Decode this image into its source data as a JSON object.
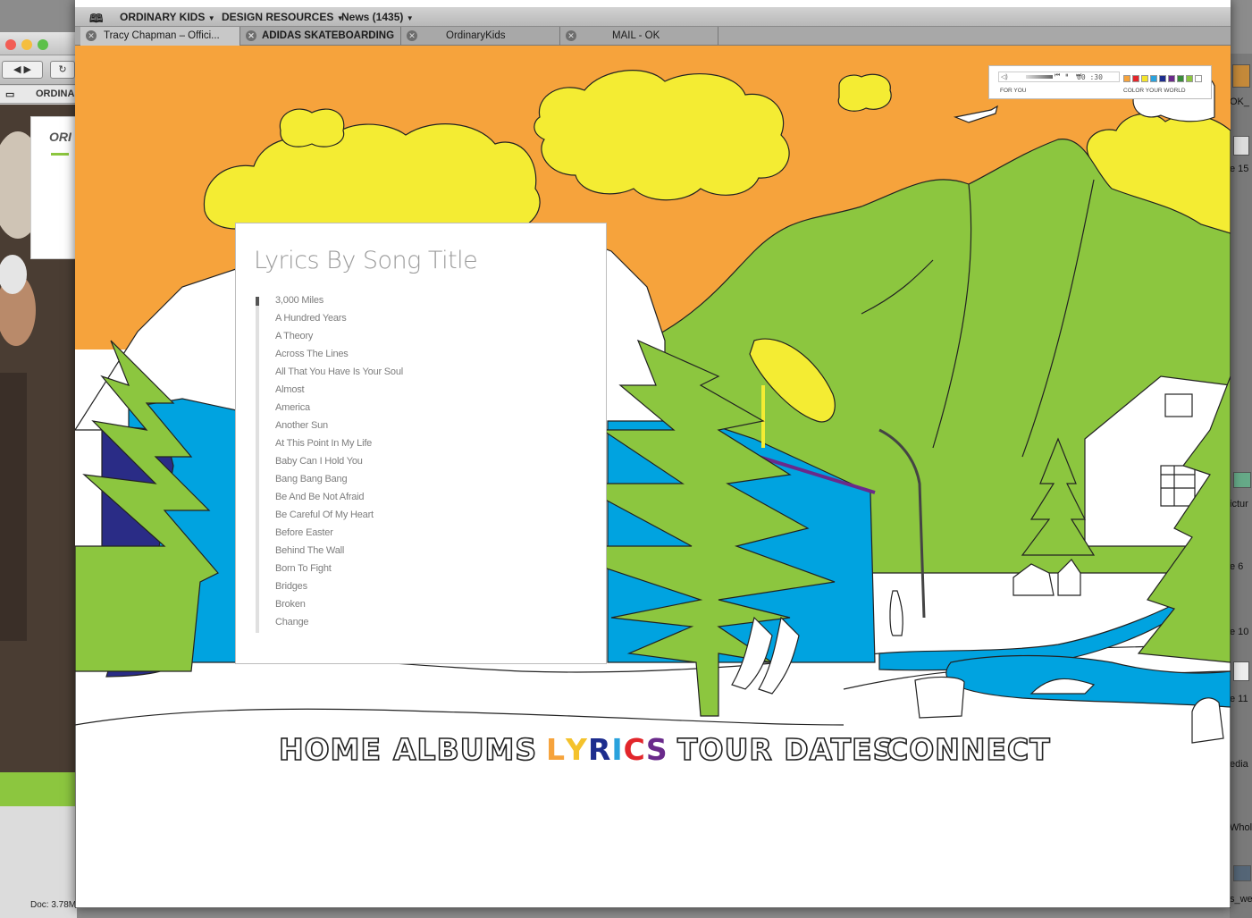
{
  "browser": {
    "bookmarks": [
      {
        "label": "ORDINARY KIDS",
        "dropdown": true
      },
      {
        "label": "DESIGN RESOURCES",
        "dropdown": true
      },
      {
        "label": "News (1435)",
        "dropdown": true
      }
    ],
    "tabs": [
      {
        "label": "Tracy Chapman – Offici...",
        "active": true
      },
      {
        "label": "ADIDAS SKATEBOARDING",
        "active": false
      },
      {
        "label": "OrdinaryKids",
        "active": false
      },
      {
        "label": "MAIL - OK",
        "active": false
      }
    ]
  },
  "background_window": {
    "bookmark_label": "ORDINA",
    "status_text": "Doc: 3.78M/"
  },
  "desktop_labels": [
    "OK_",
    "e 15",
    "ictur",
    "e 6",
    "e 10",
    "e 11",
    "edia",
    "Whol",
    "s_we"
  ],
  "player": {
    "time": "00 :30",
    "left_label": "FOR YOU",
    "right_label": "COLOR YOUR WORLD",
    "swatches": [
      "#f6a33c",
      "#e2262b",
      "#f4e42c",
      "#2aa2dd",
      "#1d2d8e",
      "#6a2a8b",
      "#3a8b3a",
      "#8cc63f",
      "#ffffff"
    ]
  },
  "lyrics": {
    "title": "Lyrics By Song Title",
    "songs": [
      "3,000 Miles",
      "A Hundred Years",
      "A Theory",
      "Across The Lines",
      "All That You Have Is Your Soul",
      "Almost",
      "America",
      "Another Sun",
      "At This Point In My Life",
      "Baby Can I Hold You",
      "Bang Bang Bang",
      "Be And Be Not Afraid",
      "Be Careful Of My Heart",
      "Before Easter",
      "Behind The Wall",
      "Born To Fight",
      "Bridges",
      "Broken",
      "Change"
    ]
  },
  "nav": {
    "items": [
      "HOME",
      "ALBUMS",
      "LYRICS",
      "TOUR DATES",
      "CONNECT"
    ],
    "active": "LYRICS",
    "active_letter_colors": [
      "#f6a33c",
      "#f4c22c",
      "#1d2d8e",
      "#2aa2dd",
      "#e2262b",
      "#6a2a8b"
    ]
  },
  "colors": {
    "sky": "#f6a33c",
    "cloud": "#f4ec33",
    "mountain": "#8cc63f",
    "building": "#00a3e0",
    "building_dark": "#2a2c86"
  }
}
